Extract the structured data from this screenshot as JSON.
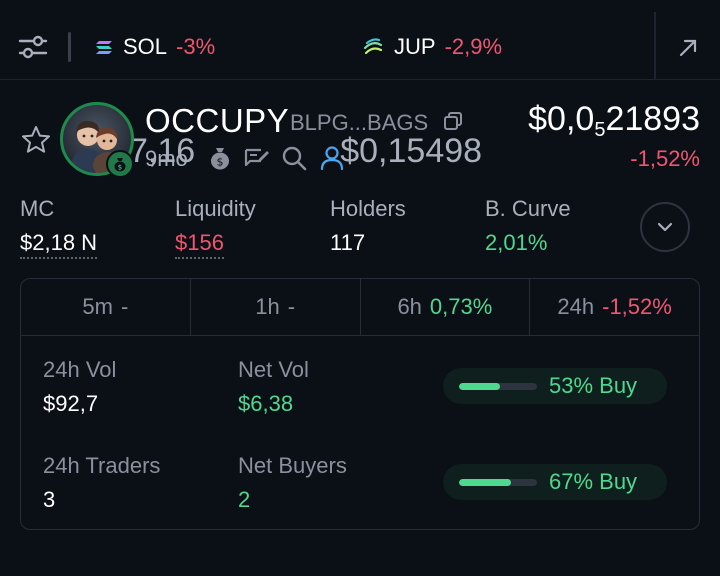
{
  "colors": {
    "positive": "#4fd88f",
    "negative": "#f0566f",
    "background": "#0b0f16"
  },
  "ticker": {
    "items": [
      {
        "symbol": "SOL",
        "price": "$87,16",
        "change": "-3%",
        "icon": "solana-icon"
      },
      {
        "symbol": "JUP",
        "price": "$0,15498",
        "change": "-2,9%",
        "icon": "jupiter-icon"
      }
    ]
  },
  "token": {
    "name": "OCCUPY",
    "address": "BLPG...BAGS",
    "age": "9mo",
    "price_prefix": "$0,0",
    "price_zeros": "5",
    "price_digits": "21893",
    "price_change": "-1,52%"
  },
  "stats": [
    {
      "label": "MC",
      "value": "$2,18 N"
    },
    {
      "label": "Liquidity",
      "value": "$156"
    },
    {
      "label": "Holders",
      "value": "117"
    },
    {
      "label": "B. Curve",
      "value": "2,01%"
    }
  ],
  "tabs": [
    {
      "label": "5m",
      "change": "-"
    },
    {
      "label": "1h",
      "change": "-"
    },
    {
      "label": "6h",
      "change": "0,73%"
    },
    {
      "label": "24h",
      "change": "-1,52%"
    }
  ],
  "metrics": {
    "vol_24h": {
      "label": "24h Vol",
      "value": "$92,7"
    },
    "net_vol": {
      "label": "Net Vol",
      "value": "$6,38"
    },
    "traders_24h": {
      "label": "24h Traders",
      "value": "3"
    },
    "net_buyers": {
      "label": "Net Buyers",
      "value": "2"
    }
  },
  "buy_ratio": [
    {
      "label": "53% Buy",
      "fraction": 0.53
    },
    {
      "label": "67% Buy",
      "fraction": 0.67
    }
  ]
}
